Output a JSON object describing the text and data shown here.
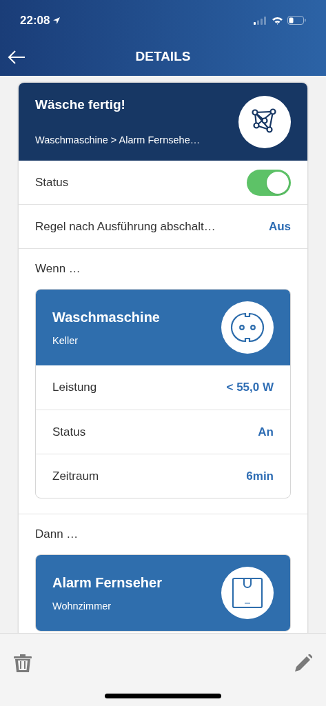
{
  "status_bar": {
    "time": "22:08"
  },
  "nav": {
    "title": "DETAILS"
  },
  "rule": {
    "title": "Wäsche fertig!",
    "subtitle": "Waschmaschine > Alarm Fernsehe…"
  },
  "settings": [
    {
      "kind": "toggle",
      "label": "Status",
      "on": true
    },
    {
      "kind": "value",
      "label": "Regel nach Ausführung abschalt…",
      "value": "Aus"
    }
  ],
  "sections": [
    {
      "heading": "Wenn …",
      "device": {
        "name": "Waschmaschine",
        "room": "Keller",
        "kind": "socket"
      },
      "properties": [
        {
          "label": "Leistung",
          "value": "< 55,0 W"
        },
        {
          "label": "Status",
          "value": "An"
        },
        {
          "label": "Zeitraum",
          "value": "6min"
        }
      ]
    },
    {
      "heading": "Dann …",
      "device": {
        "name": "Alarm Fernseher",
        "room": "Wohnzimmer",
        "kind": "sensor"
      }
    }
  ]
}
